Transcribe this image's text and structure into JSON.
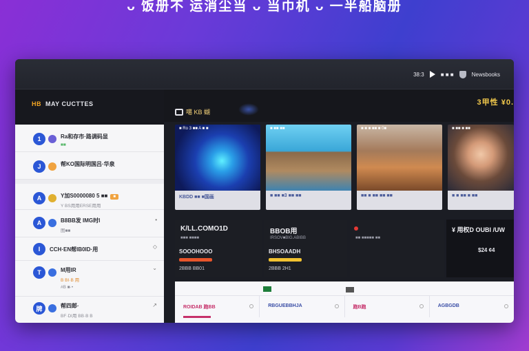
{
  "headline": "ᴗ 饭册不 运消尘当 ᴗ 当巾机 ᴗ 一半船脑册",
  "topbar": {
    "time": "38:3",
    "status": "■ ■ ■",
    "account": "Newsbooks"
  },
  "nav": {
    "accent": "HB",
    "title": "MAY CUCTTES"
  },
  "sidebar": {
    "items": [
      {
        "num": "1",
        "dot": "#6a5fd6",
        "title": "Ra和存市·路调码显",
        "sub": "■■",
        "sub_style": "green",
        "right": ""
      },
      {
        "num": "J",
        "dot": "#f0a340",
        "title": "帮KO国际明国吕·华泉",
        "sub": "",
        "sub_style": "",
        "right": ""
      },
      {
        "num": "A",
        "dot": "#e0b030",
        "title": "Y加S0000080 5 ■■",
        "tag": "■",
        "sub": "Y BS用用ERSE用用",
        "sub_style": "",
        "right": ""
      },
      {
        "num": "A",
        "dot": "#3a6fe0",
        "title": "B8BB发 IMG时I",
        "sub": "图■■",
        "sub_style": "",
        "right": "•"
      },
      {
        "num": "I",
        "dot": "",
        "title": "CCH·EN帮IB0ID·用",
        "sub": "",
        "sub_style": "",
        "right": "◇"
      },
      {
        "num": "T",
        "dot": "#3a6fe0",
        "title": "M用IR",
        "sub": "B BI·B 用",
        "sub_style": "orange",
        "sub2": "#B ■·•",
        "right": "⌄"
      },
      {
        "num": "牌",
        "dot": "#3a6fe0",
        "title": "帮四郎·",
        "sub": "BF·DI用 BB·B B",
        "sub_style": "",
        "right": "↗"
      }
    ]
  },
  "main": {
    "section_label": "噶 KB 蝴",
    "price": "3甲性 ¥0.",
    "cards": [
      {
        "top": "■ Ro 3 ■■ A ■ ■",
        "caption": "KBDD ■■ ■国画",
        "img": "blue"
      },
      {
        "top": "■ ■■ ■■",
        "caption": "■ ■■ ■3 ■■ ■■",
        "img": "cyan"
      },
      {
        "top": "■ ■ ■ ■■ ■ 0■",
        "caption": "■■ ■ ■■ ■■ ■■",
        "img": "warm"
      },
      {
        "top": "■ ■■ ■ ■■",
        "caption": "■ ■ ■■ ■ ■■",
        "img": "girl"
      }
    ],
    "stats": [
      {
        "title": "K/LL.COMO1D",
        "sub": "■■■ ■■■■",
        "big": "SOOOHOOO",
        "bar": "#e8552b",
        "foot": "2BBB BB01"
      },
      {
        "title": "BBOB用",
        "sub": "IRSOV■BIG.ABIBB",
        "big": "BHSOAADH",
        "bar": "#f2c230",
        "foot": "2BBB 2H1"
      },
      {
        "title": "",
        "sub": "■■ ■■■■■ ■■",
        "big": "",
        "bar": "",
        "foot": ""
      },
      {
        "title": "¥ 用权D OUBI /UW",
        "sub": "",
        "big": "$24 ¢4",
        "bar": "",
        "foot": ""
      }
    ],
    "bottom": [
      {
        "label": "ROIDAB 跑BB",
        "color": "#c6306a"
      },
      {
        "label": "RBGUEBBHJA",
        "color": "#3a4ea6"
      },
      {
        "label": "跑B跑",
        "color": "#c6306a"
      },
      {
        "label": "AGBGDB",
        "color": "#3a4ea6"
      }
    ]
  },
  "colors": {
    "accent": "#2b57d6",
    "price": "#f2c94c",
    "bg_dark": "#1b1d24"
  }
}
